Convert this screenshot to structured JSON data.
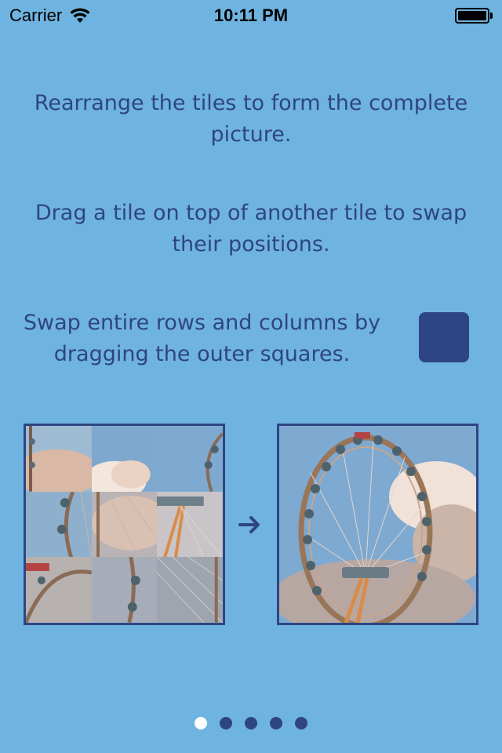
{
  "status_bar": {
    "carrier": "Carrier",
    "time": "10:11 PM",
    "icons": [
      "wifi-icon",
      "battery-icon"
    ]
  },
  "instructions": {
    "line1": "Rearrange the tiles to form the complete picture.",
    "line2": "Drag a tile on top of another tile to swap their positions.",
    "line3": "Swap entire rows and columns by dragging the outer squares."
  },
  "images": {
    "scrambled_tiles_count": 9,
    "arrow_icon": "right-arrow-icon",
    "subject": "ferris-wheel"
  },
  "pagination": {
    "total": 5,
    "current": 1
  },
  "colors": {
    "background": "#6fb3e0",
    "text": "#2e4583",
    "accent": "#2e4583",
    "active_dot": "#ffffff"
  }
}
